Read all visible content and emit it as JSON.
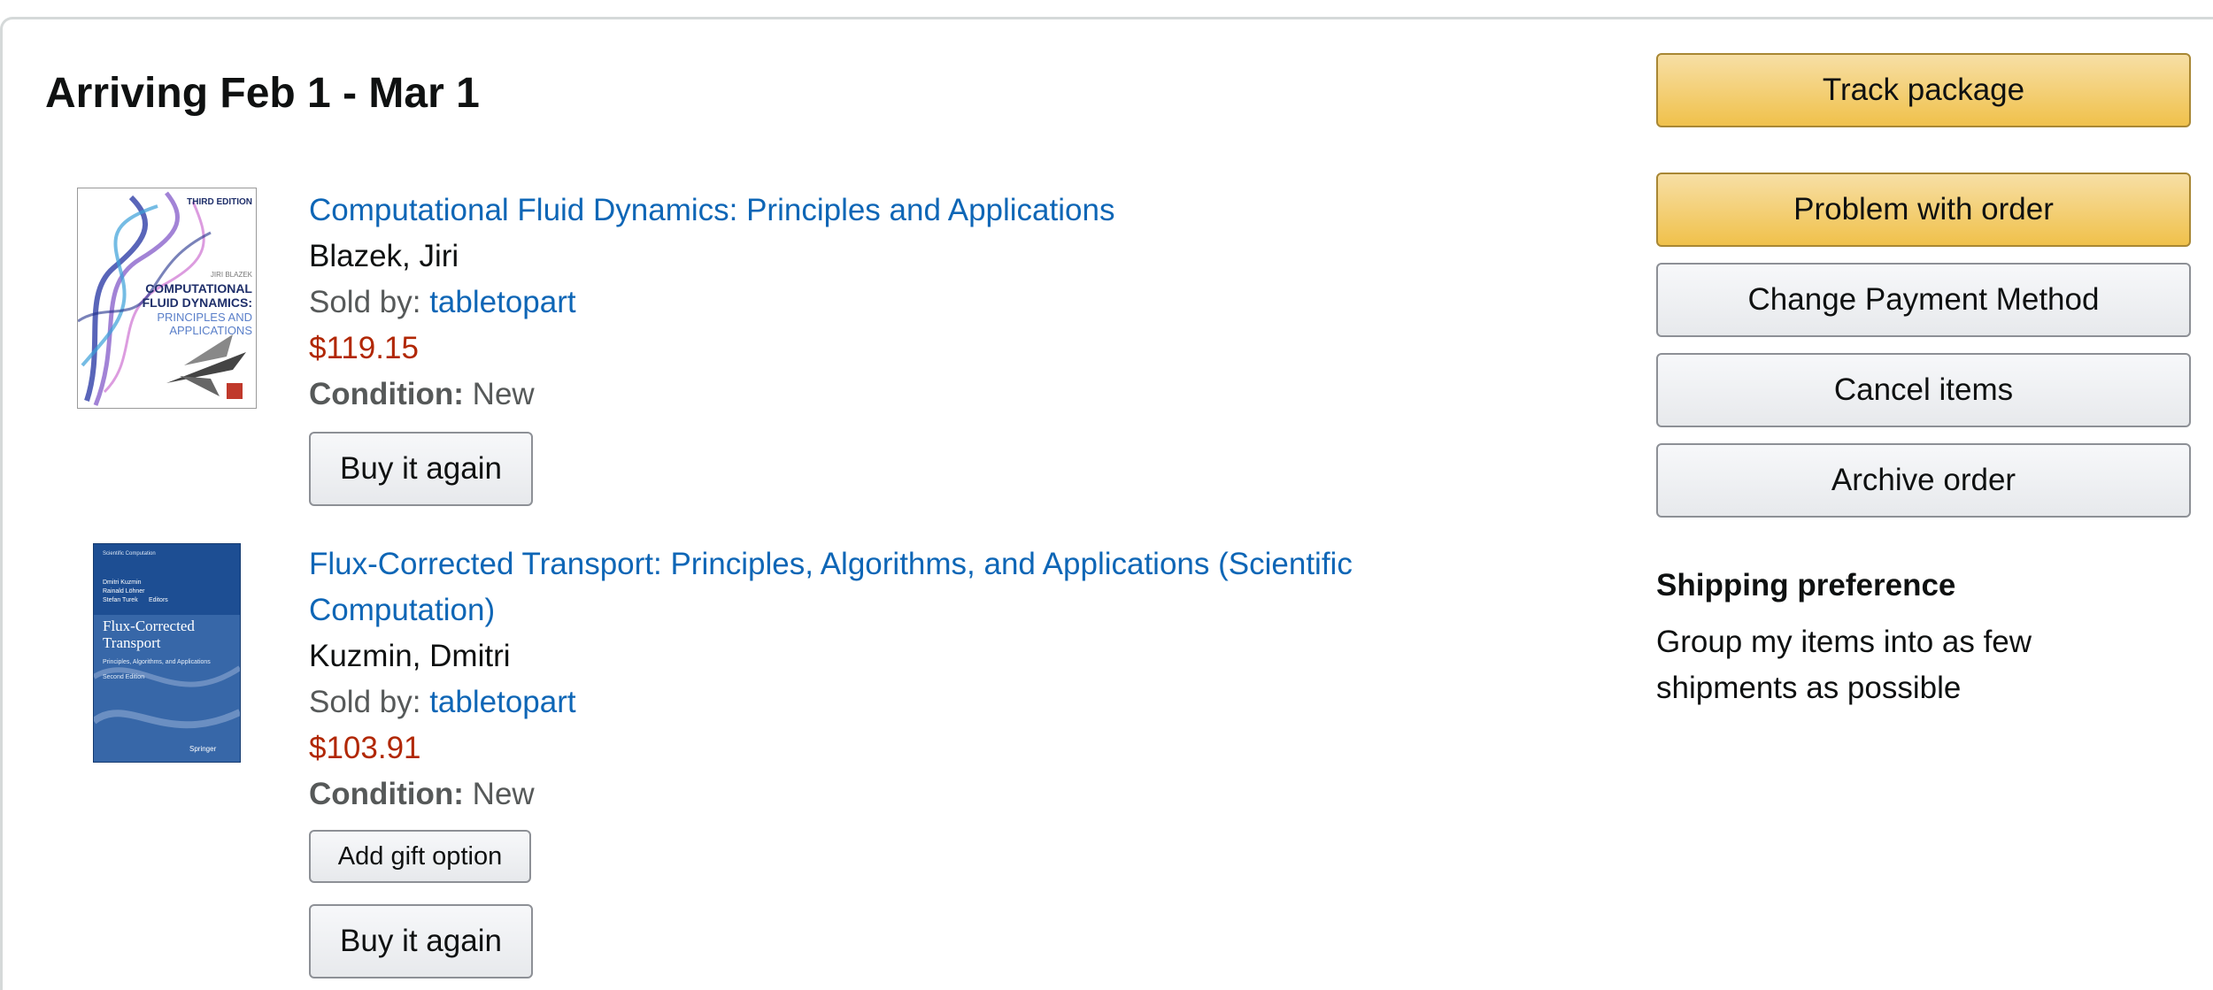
{
  "shipment": {
    "heading": "Arriving Feb 1 - Mar 1"
  },
  "items": [
    {
      "title": "Computational Fluid Dynamics: Principles and Applications",
      "author": "Blazek, Jiri",
      "sold_by_label": "Sold by:",
      "seller": "tabletopart",
      "price": "$119.15",
      "condition_label": "Condition:",
      "condition": "New",
      "buy_again_label": "Buy it again",
      "cover": {
        "edition": "THIRD EDITION",
        "author": "JIRI BLAZEK",
        "title_line1": "COMPUTATIONAL",
        "title_line2": "FLUID DYNAMICS:",
        "subtitle_line1": "PRINCIPLES AND",
        "subtitle_line2": "APPLICATIONS"
      }
    },
    {
      "title": "Flux-Corrected Transport: Principles, Algorithms, and Applications (Scientific Computation)",
      "author": "Kuzmin, Dmitri",
      "sold_by_label": "Sold by:",
      "seller": "tabletopart",
      "price": "$103.91",
      "condition_label": "Condition:",
      "condition": "New",
      "gift_option_label": "Add gift option",
      "buy_again_label": "Buy it again",
      "cover": {
        "series": "Scientific Computation",
        "editors_line1": "Dmitri Kuzmin",
        "editors_line2": "Rainald Löhner",
        "editors_line3": "Stefan Turek",
        "editors_suffix": "Editors",
        "title_line1": "Flux-Corrected",
        "title_line2": "Transport",
        "subtitle": "Principles, Algorithms, and Applications",
        "edition": "Second Edition",
        "publisher": "Springer"
      }
    }
  ],
  "actions": {
    "track_package": "Track package",
    "problem_with_order": "Problem with order",
    "change_payment": "Change Payment Method",
    "cancel_items": "Cancel items",
    "archive_order": "Archive order"
  },
  "shipping_preference": {
    "label": "Shipping preference",
    "text": "Group my items into as few shipments as possible"
  },
  "colors": {
    "link": "#0e66b6",
    "price": "#b12704",
    "primary_button": "#f0c14b",
    "secondary_button": "#e7e9ec",
    "text_secondary": "#565959"
  }
}
